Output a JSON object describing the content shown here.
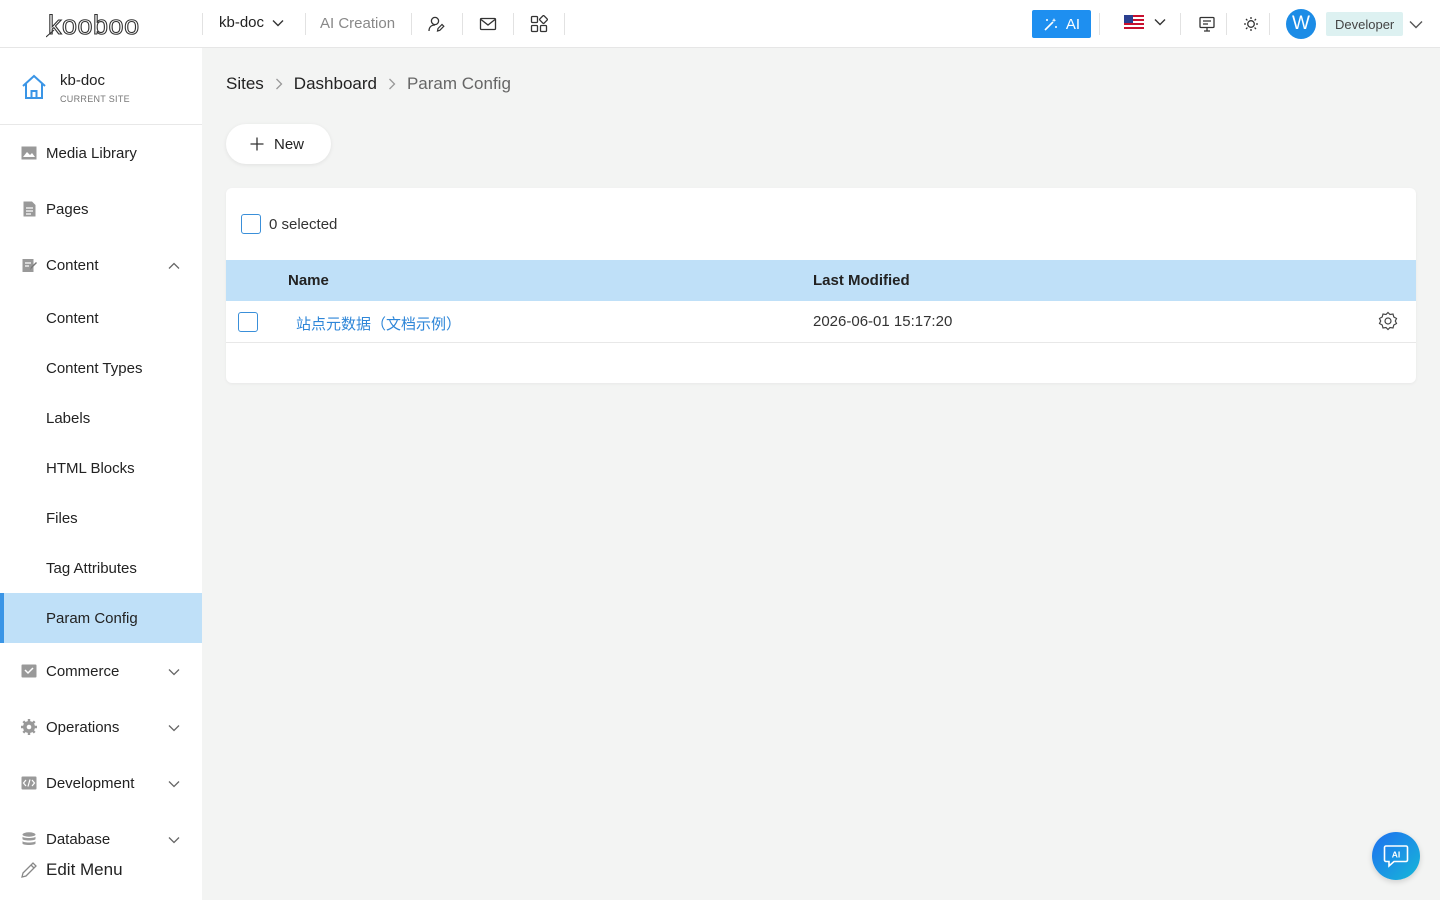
{
  "topbar": {
    "logo_text": "kooboo",
    "site_selector": "kb-doc",
    "ai_creation": "AI Creation",
    "ai_button": "AI",
    "avatar_initial": "W",
    "role": "Developer",
    "icons": [
      "user-edit-icon",
      "mail-icon",
      "apps-icon",
      "flag-us-icon",
      "monitor-icon",
      "sun-icon"
    ]
  },
  "sidebar": {
    "site_name": "kb-doc",
    "site_sub": "CURRENT SITE",
    "items": [
      {
        "label": "Media Library",
        "icon": "image-icon"
      },
      {
        "label": "Pages",
        "icon": "document-icon"
      },
      {
        "label": "Content",
        "icon": "edit-doc-icon",
        "expanded": true
      },
      {
        "label": "Content"
      },
      {
        "label": "Content Types"
      },
      {
        "label": "Labels"
      },
      {
        "label": "HTML Blocks"
      },
      {
        "label": "Files"
      },
      {
        "label": "Tag Attributes"
      },
      {
        "label": "Param Config",
        "active": true
      },
      {
        "label": "Commerce",
        "icon": "cart-icon"
      },
      {
        "label": "Operations",
        "icon": "gear-icon"
      },
      {
        "label": "Development",
        "icon": "code-icon"
      },
      {
        "label": "Database",
        "icon": "database-icon"
      }
    ],
    "edit_menu": "Edit Menu"
  },
  "breadcrumb": [
    "Sites",
    "Dashboard",
    "Param Config"
  ],
  "main": {
    "new_button": "New",
    "selected_text": "0 selected",
    "columns": [
      "Name",
      "Last Modified"
    ],
    "rows": [
      {
        "name": "站点元数据（文档示例）",
        "last_modified": "2026-06-01 15:17:20"
      }
    ]
  },
  "fab_label": "AI",
  "colors": {
    "accent": "#1e8ff0",
    "active_bg": "#bfe0f8",
    "link": "#2e86d8",
    "page_bg": "#f3f4f3"
  }
}
